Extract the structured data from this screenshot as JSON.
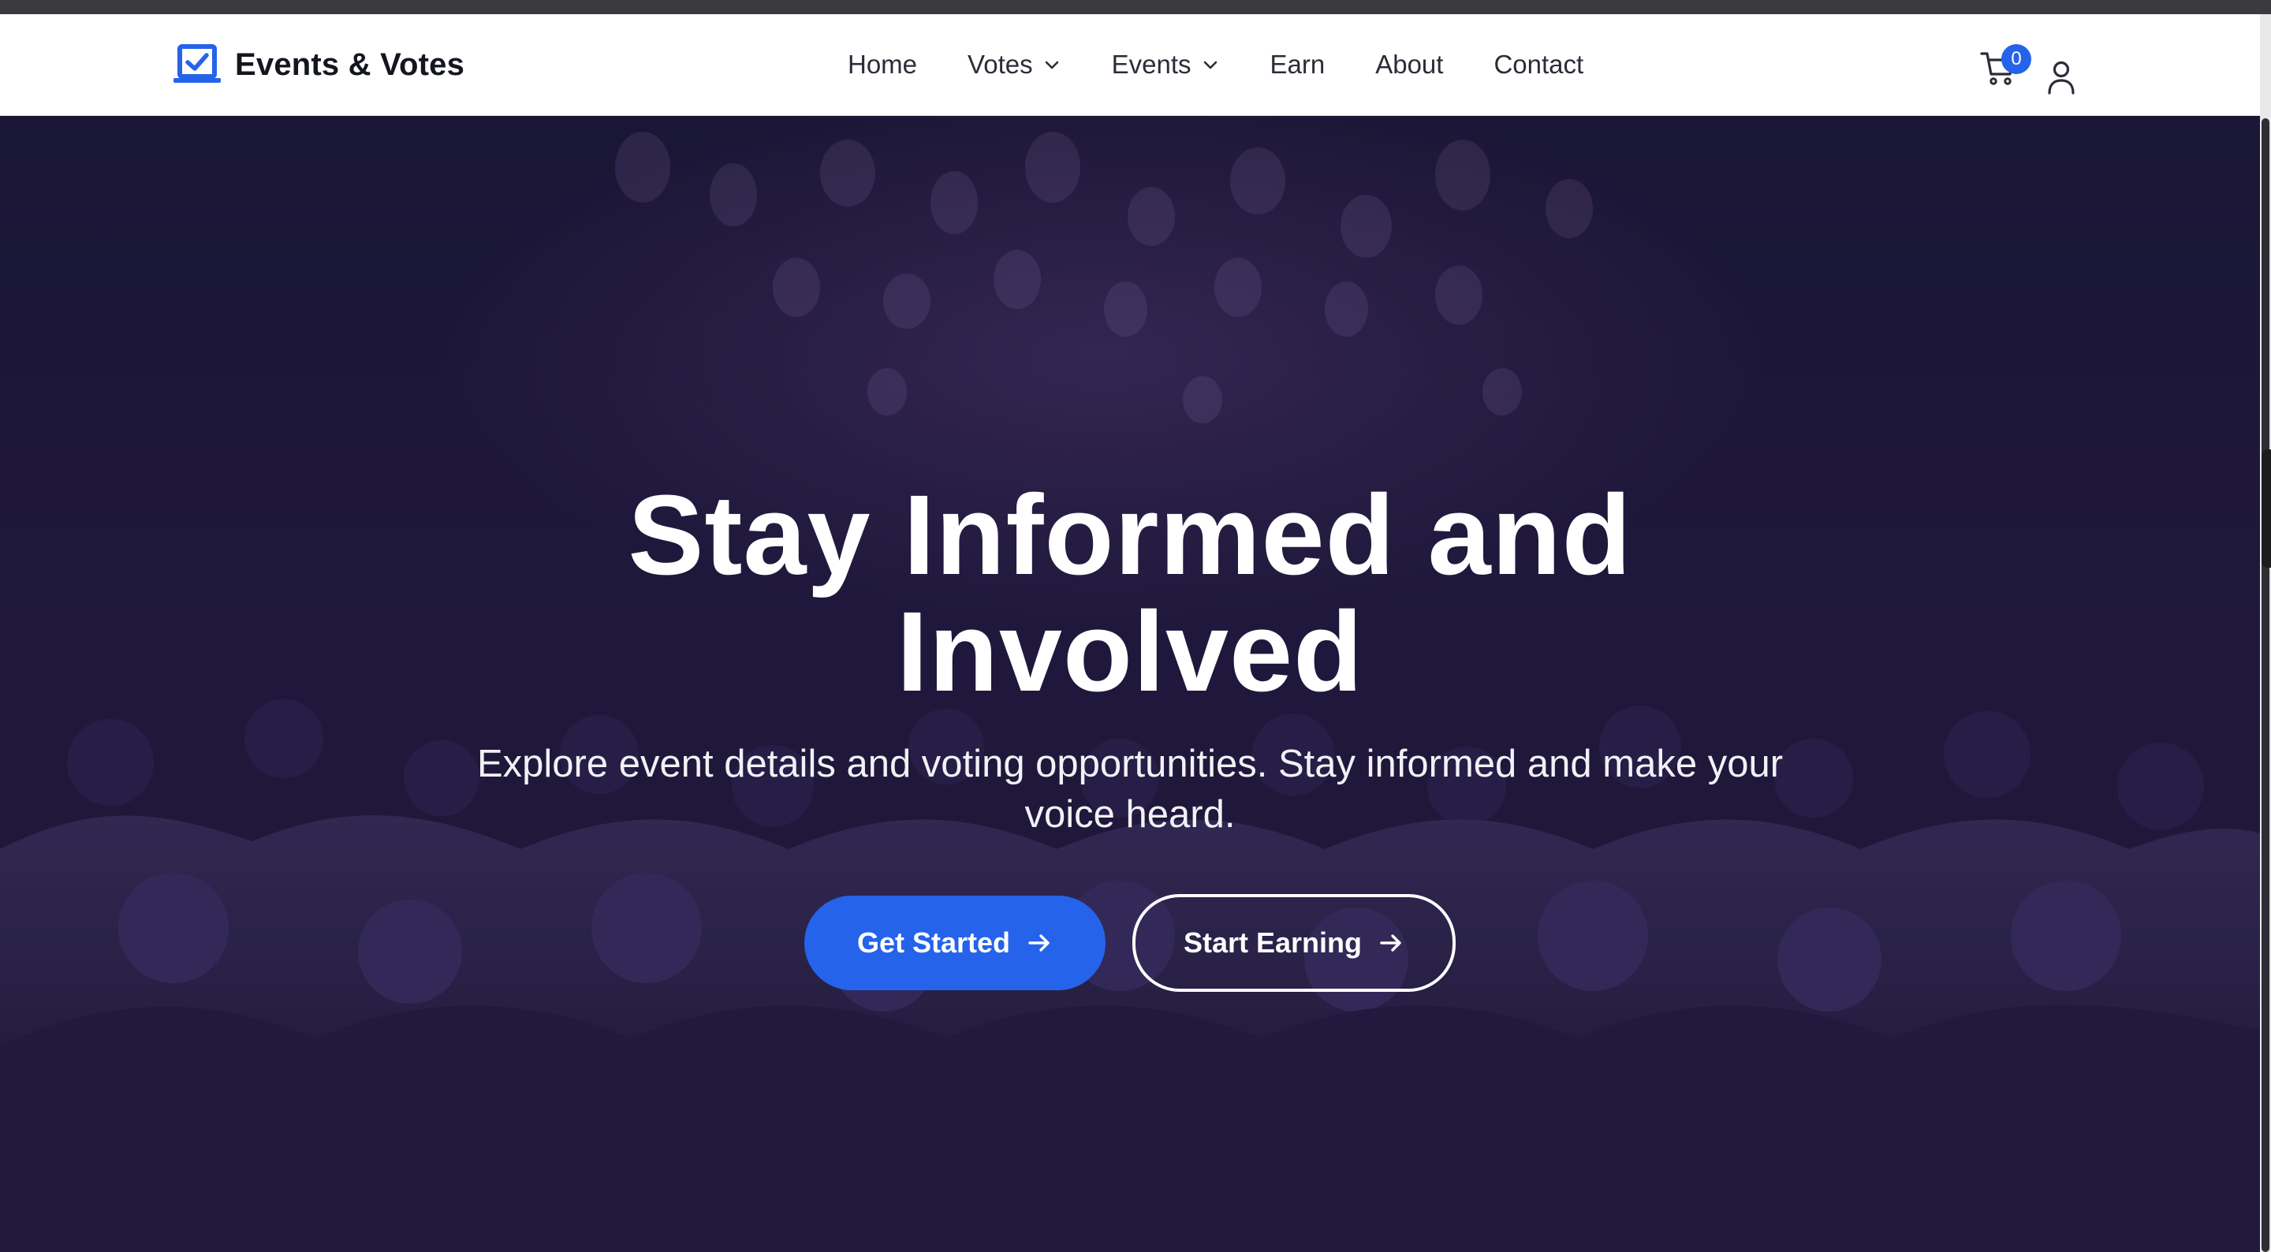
{
  "brand": {
    "name": "Events & Votes",
    "icon": "ballot-check-icon",
    "accent": "#2563eb"
  },
  "nav": {
    "items": [
      {
        "label": "Home",
        "dropdown": false
      },
      {
        "label": "Votes",
        "dropdown": true
      },
      {
        "label": "Events",
        "dropdown": true
      },
      {
        "label": "Earn",
        "dropdown": false
      },
      {
        "label": "About",
        "dropdown": false
      },
      {
        "label": "Contact",
        "dropdown": false
      }
    ]
  },
  "header_actions": {
    "cart_icon": "cart-icon",
    "cart_count": "0",
    "user_icon": "user-icon"
  },
  "hero": {
    "headline_line1": "Stay Informed and",
    "headline_line2": "Involved",
    "subtitle": "Explore event details and voting opportunities. Stay informed and make your voice heard.",
    "primary_button": "Get Started",
    "secondary_button": "Start Earning",
    "button_icon": "arrow-right-icon",
    "background": "conference-audience-photo"
  },
  "colors": {
    "primary": "#2563eb",
    "hero_tint": "#221a3e",
    "header_bg": "#ffffff",
    "text_dark": "#14161f"
  }
}
